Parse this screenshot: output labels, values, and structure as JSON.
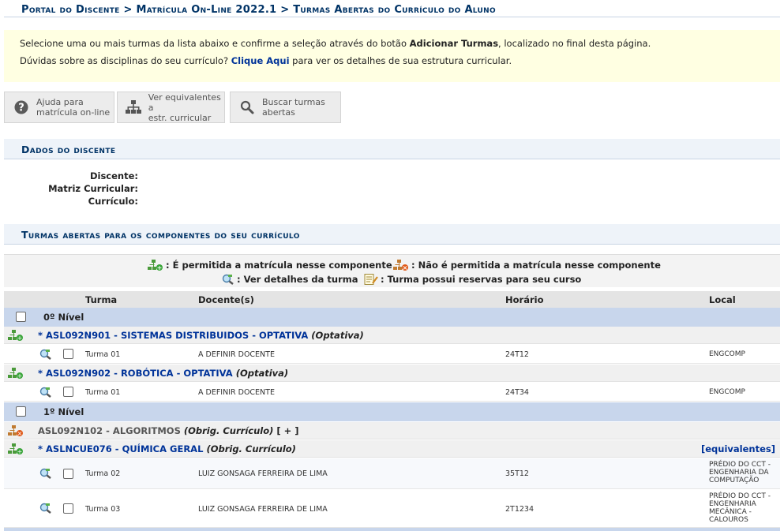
{
  "breadcrumb": "Portal do Discente > Matrícula On-Line 2022.1 > Turmas Abertas do Currículo do Aluno",
  "notice": {
    "line1_pre": "Selecione uma ou mais turmas da lista abaixo e confirme a seleção através do botão ",
    "line1_bold": "Adicionar Turmas",
    "line1_post": ", localizado no final desta página.",
    "line2_pre": "Dúvidas sobre as disciplinas do seu currículo? ",
    "line2_link": "Clique Aqui",
    "line2_post": " para ver os detalhes de sua estrutura curricular."
  },
  "toolbar": {
    "help": "Ajuda para\nmatrícula on-line",
    "equiv": "Ver equivalentes a\nestr. curricular",
    "search": "Buscar turmas\nabertas"
  },
  "dados": {
    "title": "Dados do discente",
    "discente_label": "Discente:",
    "matriz_label": "Matriz Curricular:",
    "curriculo_label": "Currículo:"
  },
  "turmas_title": "Turmas abertas para os componentes do seu currículo",
  "legend": {
    "permitida": ": É permitida a matrícula nesse componente",
    "nao_permitida": ": Não é permitida a matrícula nesse componente",
    "detalhes": ": Ver detalhes da turma",
    "reservas": ": Turma possui reservas para seu curso"
  },
  "table_headers": {
    "turma": "Turma",
    "docente": "Docente(s)",
    "horario": "Horário",
    "local": "Local"
  },
  "niveis": [
    "0º Nível",
    "1º Nível"
  ],
  "components": [
    {
      "code_name": "* ASL092N901 - SISTEMAS DISTRIBUIDOS - OPTATIVA",
      "type": "(Optativa)"
    },
    {
      "code_name": "* ASL092N902 - ROBÓTICA - OPTATIVA",
      "type": "(Optativa)"
    },
    {
      "code_name": "ASL092N102 - ALGORITMOS",
      "type": "(Obrig. Currículo)",
      "extra": "[ + ]"
    },
    {
      "code_name": "* ASLNCUE076 - QUÍMICA GERAL",
      "type": "(Obrig. Currículo)",
      "equiv": "[equivalentes]"
    }
  ],
  "turmas": [
    {
      "turma": "Turma 01",
      "docente": "A DEFINIR DOCENTE",
      "horario": "24T12",
      "local": "ENGCOMP"
    },
    {
      "turma": "Turma 01",
      "docente": "A DEFINIR DOCENTE",
      "horario": "24T34",
      "local": "ENGCOMP"
    },
    {
      "turma": "Turma 02",
      "docente": "LUIZ GONSAGA FERREIRA DE LIMA",
      "horario": "35T12",
      "local": "PRÉDIO DO CCT - ENGENHARIA DA COMPUTAÇÃO"
    },
    {
      "turma": "Turma 03",
      "docente": "LUIZ GONSAGA FERREIRA DE LIMA",
      "horario": "2T1234",
      "local": "PRÉDIO DO CCT - ENGENHARIA MECÂNICA - CALOUROS"
    }
  ],
  "colors": {
    "title": "#003366",
    "link": "#003399",
    "nivel_bg": "#c8d6ec",
    "notice_bg": "#ffffe2"
  }
}
